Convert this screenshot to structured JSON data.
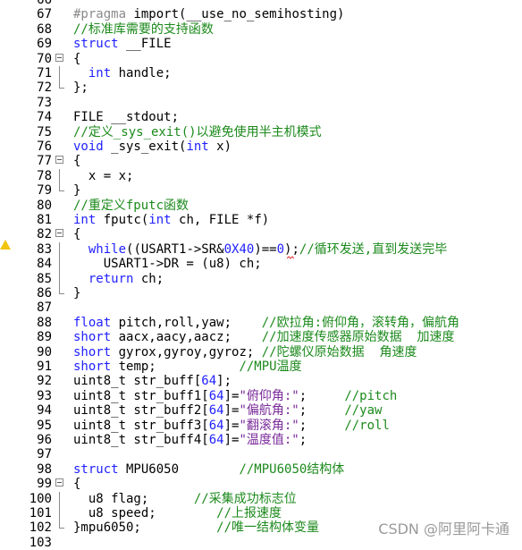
{
  "colors": {
    "keyword": "#1f1fff",
    "comment": "#1c8a1c",
    "preprocessor": "#8a8a8a",
    "string": "#7a2a9a",
    "plain": "#000000",
    "warning": "#f1c40f"
  },
  "watermark": "CSDN @阿里阿卡通",
  "warning_icon": "warning-triangle-icon",
  "lines": [
    {
      "n": "66",
      "tokens": []
    },
    {
      "n": "67",
      "tokens": [
        {
          "t": "#pragma ",
          "c": "pp"
        },
        {
          "t": "import(__use_no_semihosting)",
          "c": "pl"
        }
      ]
    },
    {
      "n": "68",
      "tokens": [
        {
          "t": "//标准库需要的支持函数",
          "c": "cm"
        }
      ]
    },
    {
      "n": "69",
      "tokens": [
        {
          "t": "struct",
          "c": "kw"
        },
        {
          "t": " __FILE",
          "c": "pl"
        }
      ]
    },
    {
      "n": "70",
      "fold": "open",
      "tokens": [
        {
          "t": "{",
          "c": "pl"
        }
      ]
    },
    {
      "n": "71",
      "fold": "mid",
      "tokens": [
        {
          "t": "  ",
          "c": "pl"
        },
        {
          "t": "int",
          "c": "kw"
        },
        {
          "t": " handle;",
          "c": "pl"
        }
      ]
    },
    {
      "n": "72",
      "fold": "end",
      "tokens": [
        {
          "t": "};",
          "c": "pl"
        }
      ]
    },
    {
      "n": "73",
      "tokens": []
    },
    {
      "n": "74",
      "tokens": [
        {
          "t": "FILE __stdout;",
          "c": "pl"
        }
      ]
    },
    {
      "n": "75",
      "tokens": [
        {
          "t": "//定义_sys_exit()以避免使用半主机模式",
          "c": "cm"
        }
      ]
    },
    {
      "n": "76",
      "tokens": [
        {
          "t": "void",
          "c": "kw"
        },
        {
          "t": " _sys_exit(",
          "c": "pl"
        },
        {
          "t": "int",
          "c": "kw"
        },
        {
          "t": " x)",
          "c": "pl"
        }
      ]
    },
    {
      "n": "77",
      "fold": "open",
      "tokens": [
        {
          "t": "{",
          "c": "pl"
        }
      ]
    },
    {
      "n": "78",
      "fold": "mid",
      "tokens": [
        {
          "t": "  x = x;",
          "c": "pl"
        }
      ]
    },
    {
      "n": "79",
      "fold": "end",
      "tokens": [
        {
          "t": "}",
          "c": "pl"
        }
      ]
    },
    {
      "n": "80",
      "tokens": [
        {
          "t": "//重定义fputc函数",
          "c": "cm"
        }
      ]
    },
    {
      "n": "81",
      "tokens": [
        {
          "t": "int",
          "c": "kw"
        },
        {
          "t": " fputc(",
          "c": "pl"
        },
        {
          "t": "int",
          "c": "kw"
        },
        {
          "t": " ch, FILE *f)",
          "c": "pl"
        }
      ]
    },
    {
      "n": "82",
      "fold": "open",
      "tokens": [
        {
          "t": "{",
          "c": "pl"
        }
      ]
    },
    {
      "n": "83",
      "fold": "mid",
      "tokens": [
        {
          "t": "  ",
          "c": "pl"
        },
        {
          "t": "while",
          "c": "kw"
        },
        {
          "t": "((USART1->SR&",
          "c": "pl"
        },
        {
          "t": "0X40",
          "c": "kw"
        },
        {
          "t": ")==",
          "c": "pl"
        },
        {
          "t": "0",
          "c": "kw"
        },
        {
          "t": ");",
          "c": "pl"
        },
        {
          "t": "//循环发送,直到发送完毕",
          "c": "cm"
        }
      ]
    },
    {
      "n": "84",
      "fold": "mid",
      "tokens": [
        {
          "t": "    USART1->DR = (u8) ch;",
          "c": "pl"
        }
      ]
    },
    {
      "n": "85",
      "fold": "mid",
      "tokens": [
        {
          "t": "  ",
          "c": "pl"
        },
        {
          "t": "return",
          "c": "kw"
        },
        {
          "t": " ch;",
          "c": "pl"
        }
      ]
    },
    {
      "n": "86",
      "fold": "end",
      "tokens": [
        {
          "t": "}",
          "c": "pl"
        }
      ]
    },
    {
      "n": "87",
      "tokens": []
    },
    {
      "n": "88",
      "tokens": [
        {
          "t": "float",
          "c": "kw"
        },
        {
          "t": " pitch,roll,yaw;    ",
          "c": "pl"
        },
        {
          "t": "//欧拉角:俯仰角，滚转角，偏航角",
          "c": "cm"
        }
      ]
    },
    {
      "n": "89",
      "tokens": [
        {
          "t": "short",
          "c": "kw"
        },
        {
          "t": " aacx,aacy,aacz;    ",
          "c": "pl"
        },
        {
          "t": "//加速度传感器原始数据  加速度",
          "c": "cm"
        }
      ]
    },
    {
      "n": "90",
      "tokens": [
        {
          "t": "short",
          "c": "kw"
        },
        {
          "t": " gyrox,gyroy,gyroz; ",
          "c": "pl"
        },
        {
          "t": "//陀螺仪原始数据  角速度",
          "c": "cm"
        }
      ]
    },
    {
      "n": "91",
      "tokens": [
        {
          "t": "short",
          "c": "kw"
        },
        {
          "t": " temp;           ",
          "c": "pl"
        },
        {
          "t": "//MPU温度",
          "c": "cm"
        }
      ]
    },
    {
      "n": "92",
      "tokens": [
        {
          "t": "uint8_t str_buff[",
          "c": "pl"
        },
        {
          "t": "64",
          "c": "kw"
        },
        {
          "t": "];",
          "c": "pl"
        }
      ]
    },
    {
      "n": "93",
      "tokens": [
        {
          "t": "uint8_t str_buff1[",
          "c": "pl"
        },
        {
          "t": "64",
          "c": "kw"
        },
        {
          "t": "]=",
          "c": "pl"
        },
        {
          "t": "\"俯仰角:\"",
          "c": "str"
        },
        {
          "t": ";     ",
          "c": "pl"
        },
        {
          "t": "//pitch",
          "c": "cm"
        }
      ]
    },
    {
      "n": "94",
      "tokens": [
        {
          "t": "uint8_t str_buff2[",
          "c": "pl"
        },
        {
          "t": "64",
          "c": "kw"
        },
        {
          "t": "]=",
          "c": "pl"
        },
        {
          "t": "\"偏航角:\"",
          "c": "str"
        },
        {
          "t": ";     ",
          "c": "pl"
        },
        {
          "t": "//yaw",
          "c": "cm"
        }
      ]
    },
    {
      "n": "95",
      "tokens": [
        {
          "t": "uint8_t str_buff3[",
          "c": "pl"
        },
        {
          "t": "64",
          "c": "kw"
        },
        {
          "t": "]=",
          "c": "pl"
        },
        {
          "t": "\"翻滚角:\"",
          "c": "str"
        },
        {
          "t": ";     ",
          "c": "pl"
        },
        {
          "t": "//roll",
          "c": "cm"
        }
      ]
    },
    {
      "n": "96",
      "tokens": [
        {
          "t": "uint8_t str_buff4[",
          "c": "pl"
        },
        {
          "t": "64",
          "c": "kw"
        },
        {
          "t": "]=",
          "c": "pl"
        },
        {
          "t": "\"温度值:\"",
          "c": "str"
        },
        {
          "t": ";",
          "c": "pl"
        }
      ]
    },
    {
      "n": "97",
      "tokens": []
    },
    {
      "n": "98",
      "tokens": [
        {
          "t": "struct",
          "c": "kw"
        },
        {
          "t": " MPU6050        ",
          "c": "pl"
        },
        {
          "t": "//MPU6050结构体",
          "c": "cm"
        }
      ]
    },
    {
      "n": "99",
      "fold": "open",
      "tokens": [
        {
          "t": "{",
          "c": "pl"
        }
      ]
    },
    {
      "n": "100",
      "fold": "mid",
      "tokens": [
        {
          "t": "  u8 flag;      ",
          "c": "pl"
        },
        {
          "t": "//采集成功标志位",
          "c": "cm"
        }
      ]
    },
    {
      "n": "101",
      "fold": "mid",
      "tokens": [
        {
          "t": "  u8 speed;        ",
          "c": "pl"
        },
        {
          "t": "//上报速度",
          "c": "cm"
        }
      ]
    },
    {
      "n": "102",
      "fold": "end",
      "tokens": [
        {
          "t": "}mpu6050;          ",
          "c": "pl"
        },
        {
          "t": "//唯一结构体变量",
          "c": "cm"
        }
      ]
    },
    {
      "n": "103",
      "tokens": []
    }
  ]
}
